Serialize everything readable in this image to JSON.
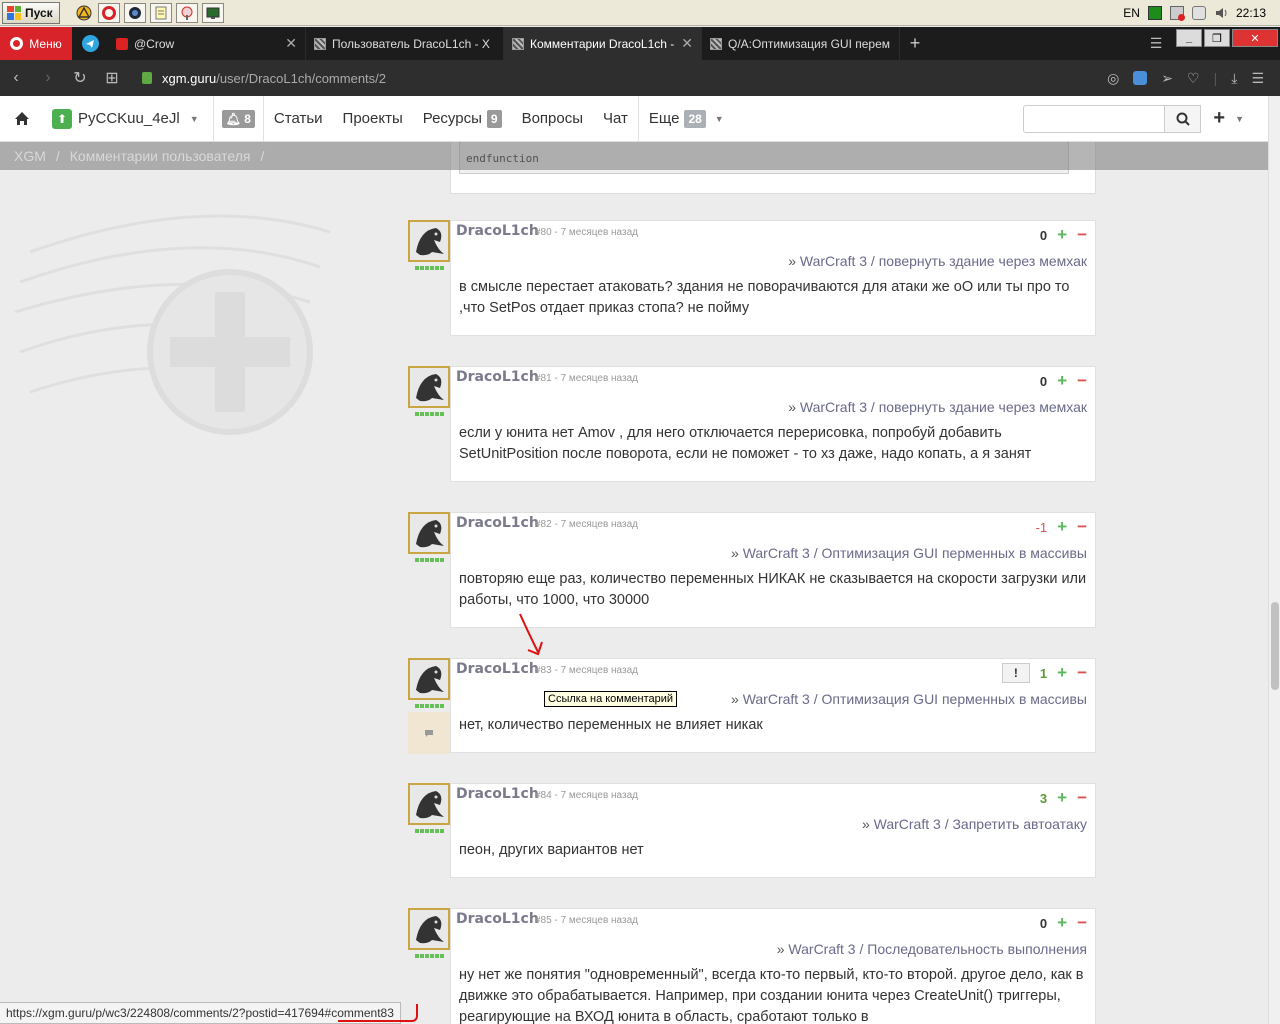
{
  "taskbar": {
    "start_label": "Пуск",
    "lang": "EN",
    "clock": "22:13"
  },
  "browser": {
    "menu_label": "Меню",
    "tabs": [
      {
        "title": "@Crow"
      },
      {
        "title": "Пользователь DracoL1ch - X"
      },
      {
        "title": "Комментарии DracoL1ch - X"
      },
      {
        "title": "Q/A:Оптимизация GUI перем"
      }
    ],
    "url_host": "xgm.guru",
    "url_path": "/user/DracoL1ch/comments/2"
  },
  "site": {
    "username": "PyCCKuu_4eJl",
    "notifications": "8",
    "nav": [
      {
        "label": "Статьи"
      },
      {
        "label": "Проекты"
      },
      {
        "label": "Ресурсы",
        "badge": "9"
      },
      {
        "label": "Вопросы"
      },
      {
        "label": "Чат"
      },
      {
        "label": "Еще",
        "badge": "28"
      }
    ],
    "search_placeholder": ""
  },
  "breadcrumb": {
    "root": "XGM",
    "sep": "/",
    "current": "Комментарии пользователя"
  },
  "code_tail": "endfunction",
  "comments": [
    {
      "author": "DracoL1ch",
      "meta": "#80 - 7 месяцев назад",
      "score": "0",
      "link_game": "WarCraft 3",
      "link_sep": "/",
      "link_topic": "повернуть здание через мемхак",
      "text": "в смысле перестает атаковать? здания не поворачиваются для атаки же оО или ты про то ,что SetPos отдает приказ стопа? не пойму"
    },
    {
      "author": "DracoL1ch",
      "meta": "#81 - 7 месяцев назад",
      "score": "0",
      "link_game": "WarCraft 3",
      "link_sep": "/",
      "link_topic": "повернуть здание через мемхак",
      "text": "если у юнита нет Amov , для него отключается перерисовка, попробуй добавить SetUnitPosition после поворота, если не поможет - то хз даже, надо копать, а я занят"
    },
    {
      "author": "DracoL1ch",
      "meta": "#82 - 7 месяцев назад",
      "score": "-1",
      "link_game": "WarCraft 3",
      "link_sep": "/",
      "link_topic": "Оптимизация GUI перменных в массивы",
      "text": "повторяю еще раз, количество переменных НИКАК не сказывается на скорости загрузки или работы, что 1000, что 30000"
    },
    {
      "author": "DracoL1ch",
      "meta": "#83 - 7 месяцев назад",
      "score": "1",
      "report": "!",
      "link_game": "WarCraft 3",
      "link_sep": "/",
      "link_topic": "Оптимизация GUI перменных в массивы",
      "text": "нет, количество переменных не влияет никак"
    },
    {
      "author": "DracoL1ch",
      "meta": "#84 - 7 месяцев назад",
      "score": "3",
      "link_game": "WarCraft 3",
      "link_sep": "/",
      "link_topic": "Запретить автоатаку",
      "text": "пеон, других вариантов нет"
    },
    {
      "author": "DracoL1ch",
      "meta": "#85 - 7 месяцев назад",
      "score": "0",
      "link_game": "WarCraft 3",
      "link_sep": "/",
      "link_topic": "Последовательность выполнения",
      "text": "ну нет же понятия \"одновременный\", всегда кто-то первый, кто-то второй. другое дело, как в движке это обрабатывается. Например, при создании юнита через CreateUnit() триггеры, реагирующие на ВХОД юнита в область, сработают только в"
    }
  ],
  "tooltip": "Ссылка на комментарий",
  "status_url": "https://xgm.guru/p/wc3/224808/comments/2?postid=417694#comment83",
  "colors": {
    "accent": "#d8232a",
    "positive": "#5cb85c",
    "negative": "#d9534f"
  }
}
